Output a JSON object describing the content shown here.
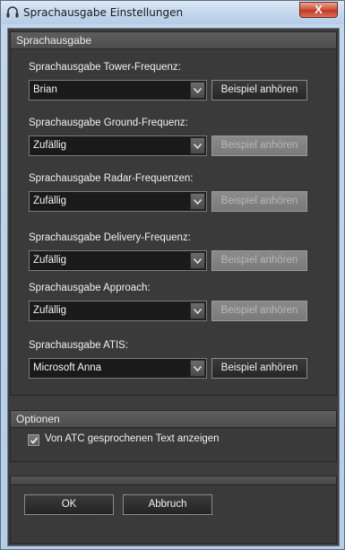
{
  "window": {
    "title": "Sprachausgabe Einstellungen",
    "close_glyph": "X"
  },
  "sprachausgabe": {
    "header": "Sprachausgabe",
    "settings": [
      {
        "label": "Sprachausgabe Tower-Frequenz:",
        "value": "Brian",
        "sample": "Beispiel anhören",
        "sample_enabled": true
      },
      {
        "label": "Sprachausgabe Ground-Frequenz:",
        "value": "Zufällig",
        "sample": "Beispiel anhören",
        "sample_enabled": false
      },
      {
        "label": "Sprachausgabe Radar-Frequenzen:",
        "value": "Zufällig",
        "sample": "Beispiel anhören",
        "sample_enabled": false
      },
      {
        "label": "Sprachausgabe Delivery-Frequenz:",
        "value": "Zufällig",
        "sample": "Beispiel anhören",
        "sample_enabled": false
      },
      {
        "label": "Sprachausgabe Approach:",
        "value": "Zufällig",
        "sample": "Beispiel anhören",
        "sample_enabled": false
      },
      {
        "label": "Sprachausgabe ATIS:",
        "value": "Microsoft Anna",
        "sample": "Beispiel anhören",
        "sample_enabled": true
      }
    ]
  },
  "optionen": {
    "header": "Optionen",
    "show_text_label": "Von ATC gesprochenen Text anzeigen",
    "show_text_checked": true
  },
  "footer": {
    "ok_label": "OK",
    "cancel_label": "Abbruch"
  },
  "icons": {
    "window_icon": "headset-icon",
    "dropdown": "chevron-down-icon",
    "check": "checkmark-icon"
  }
}
